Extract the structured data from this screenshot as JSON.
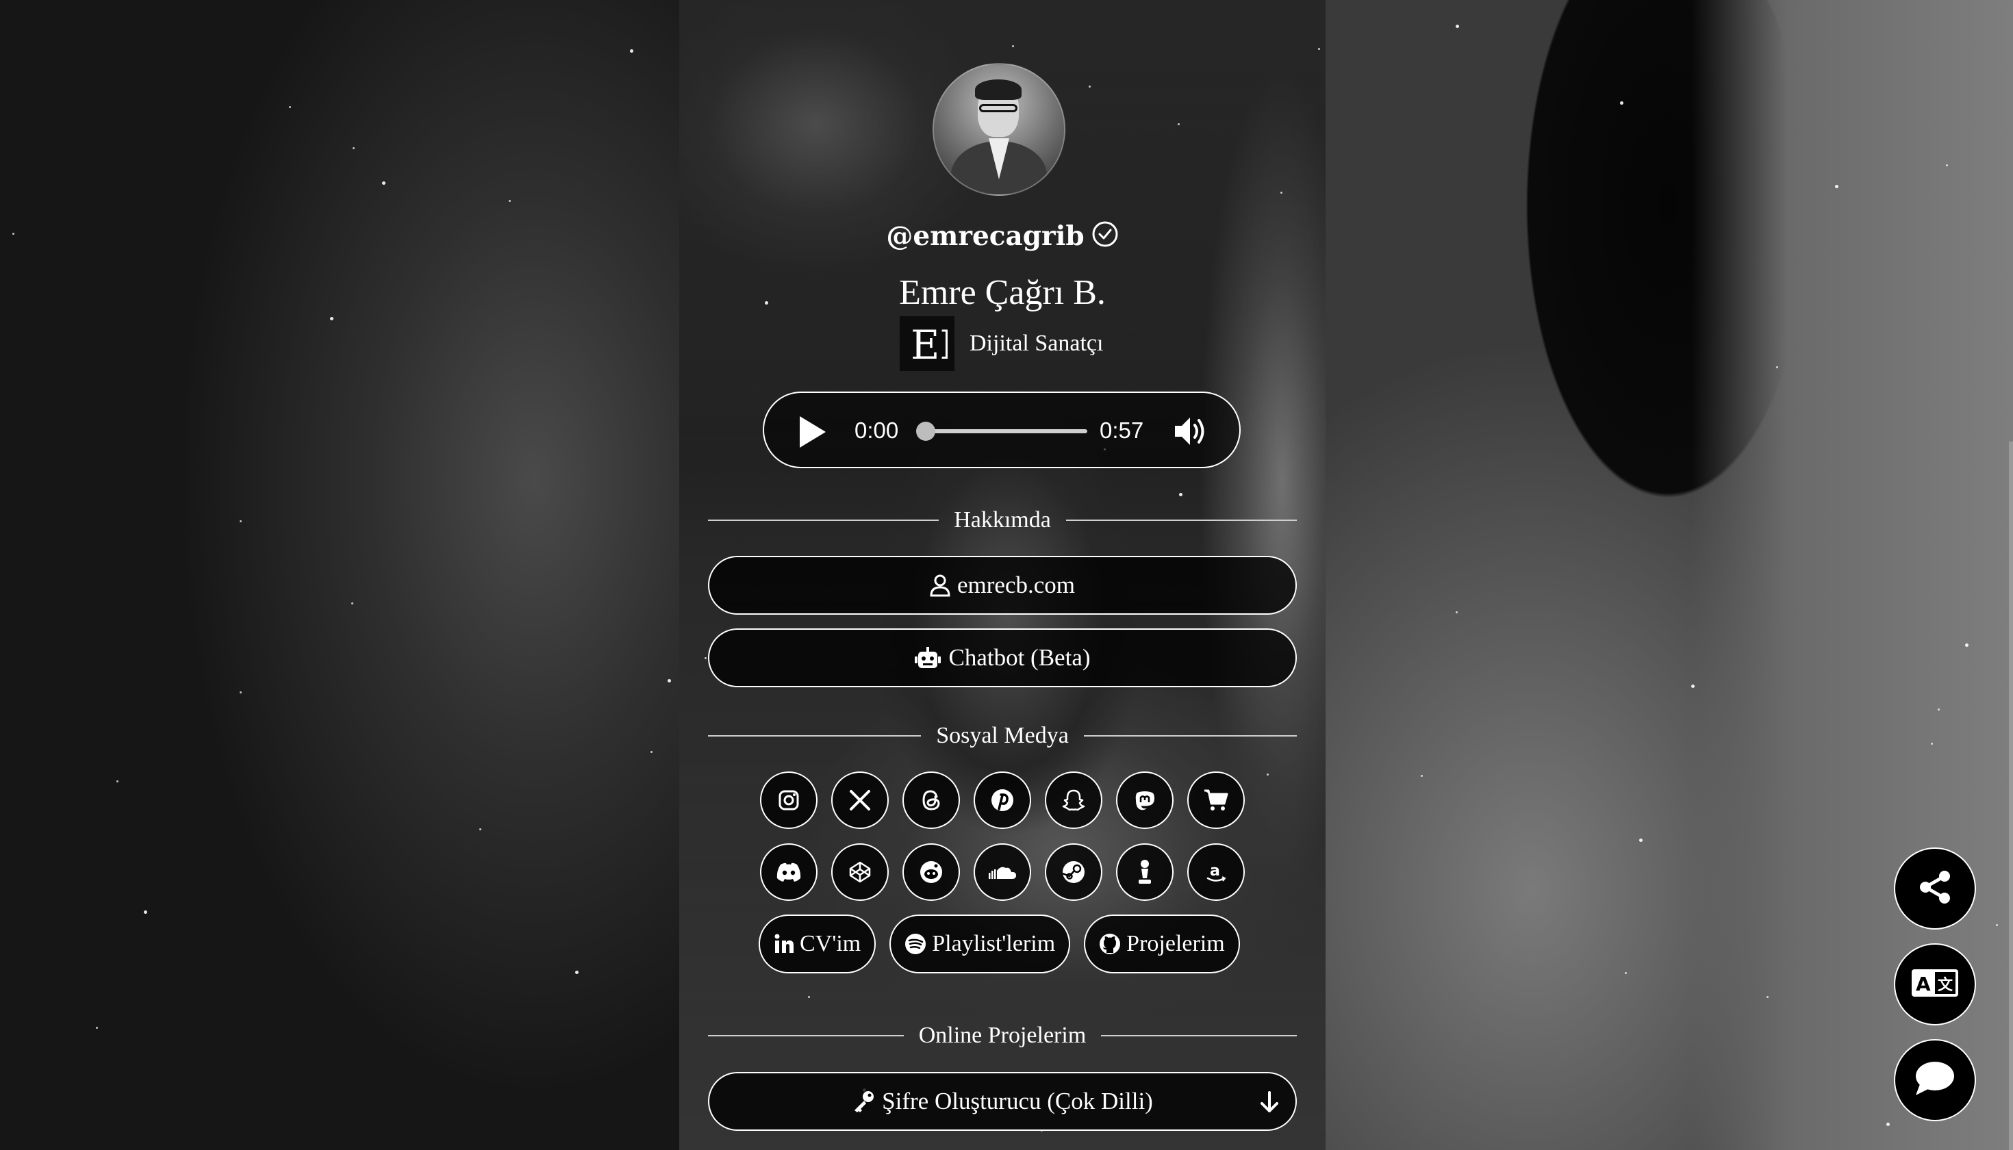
{
  "profile": {
    "handle": "@emrecagrib",
    "name": "Emre Çağrı B.",
    "role": "Dijital Sanatçı",
    "verified_icon": "check-circle-icon",
    "logo_letters": "EB"
  },
  "audio": {
    "current_time": "0:00",
    "duration": "0:57",
    "progress": 0
  },
  "sections": {
    "about": "Hakkımda",
    "social": "Sosyal Medya",
    "projects": "Online Projelerim"
  },
  "about_links": [
    {
      "label": "emrecb.com",
      "icon": "user-icon"
    },
    {
      "label": "Chatbot (Beta)",
      "icon": "robot-icon"
    }
  ],
  "social_row1": [
    "instagram-icon",
    "x-icon",
    "threads-icon",
    "pinterest-icon",
    "snapchat-icon",
    "mastodon-icon",
    "cart-icon"
  ],
  "social_row2": [
    "discord-icon",
    "codepen-icon",
    "reddit-icon",
    "soundcloud-icon",
    "steam-icon",
    "chess-icon",
    "amazon-icon"
  ],
  "link_chips": [
    {
      "label": "CV'im",
      "icon": "linkedin-icon"
    },
    {
      "label": "Playlist'lerim",
      "icon": "spotify-icon"
    },
    {
      "label": "Projelerim",
      "icon": "github-icon"
    }
  ],
  "projects": [
    {
      "label": "Şifre Oluşturucu (Çok Dilli)",
      "icon": "key-icon"
    }
  ],
  "fabs": [
    "share-icon",
    "translate-icon",
    "chat-icon"
  ],
  "colors": {
    "accent": "#ffffff",
    "background": "#000000"
  }
}
